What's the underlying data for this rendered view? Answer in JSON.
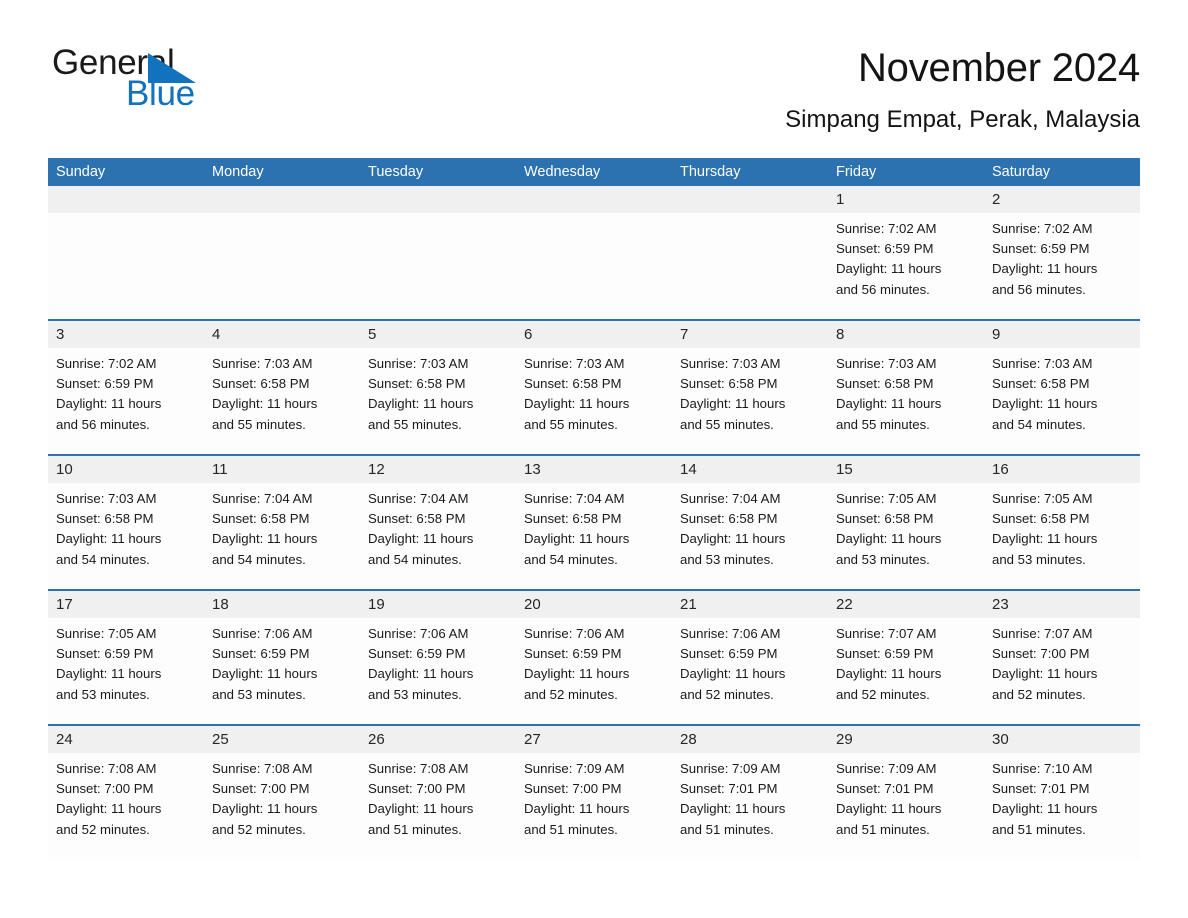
{
  "brand": {
    "name_part1": "General",
    "name_part2": "Blue",
    "triangle_icon": "triangle-icon",
    "accent_color": "#1272bd"
  },
  "header": {
    "title": "November 2024",
    "subtitle": "Simpang Empat, Perak, Malaysia"
  },
  "theme": {
    "header_blue": "#2c72b0",
    "daynum_band": "#f0f0f0",
    "cell_background": "#fdfdfd",
    "text_color": "#1a1a1a"
  },
  "weekday_headers": [
    "Sunday",
    "Monday",
    "Tuesday",
    "Wednesday",
    "Thursday",
    "Friday",
    "Saturday"
  ],
  "weeks": [
    {
      "days": [
        {
          "num": "",
          "lines": []
        },
        {
          "num": "",
          "lines": []
        },
        {
          "num": "",
          "lines": []
        },
        {
          "num": "",
          "lines": []
        },
        {
          "num": "",
          "lines": []
        },
        {
          "num": "1",
          "lines": [
            "Sunrise: 7:02 AM",
            "Sunset: 6:59 PM",
            "Daylight: 11 hours",
            "and 56 minutes."
          ]
        },
        {
          "num": "2",
          "lines": [
            "Sunrise: 7:02 AM",
            "Sunset: 6:59 PM",
            "Daylight: 11 hours",
            "and 56 minutes."
          ]
        }
      ]
    },
    {
      "days": [
        {
          "num": "3",
          "lines": [
            "Sunrise: 7:02 AM",
            "Sunset: 6:59 PM",
            "Daylight: 11 hours",
            "and 56 minutes."
          ]
        },
        {
          "num": "4",
          "lines": [
            "Sunrise: 7:03 AM",
            "Sunset: 6:58 PM",
            "Daylight: 11 hours",
            "and 55 minutes."
          ]
        },
        {
          "num": "5",
          "lines": [
            "Sunrise: 7:03 AM",
            "Sunset: 6:58 PM",
            "Daylight: 11 hours",
            "and 55 minutes."
          ]
        },
        {
          "num": "6",
          "lines": [
            "Sunrise: 7:03 AM",
            "Sunset: 6:58 PM",
            "Daylight: 11 hours",
            "and 55 minutes."
          ]
        },
        {
          "num": "7",
          "lines": [
            "Sunrise: 7:03 AM",
            "Sunset: 6:58 PM",
            "Daylight: 11 hours",
            "and 55 minutes."
          ]
        },
        {
          "num": "8",
          "lines": [
            "Sunrise: 7:03 AM",
            "Sunset: 6:58 PM",
            "Daylight: 11 hours",
            "and 55 minutes."
          ]
        },
        {
          "num": "9",
          "lines": [
            "Sunrise: 7:03 AM",
            "Sunset: 6:58 PM",
            "Daylight: 11 hours",
            "and 54 minutes."
          ]
        }
      ]
    },
    {
      "days": [
        {
          "num": "10",
          "lines": [
            "Sunrise: 7:03 AM",
            "Sunset: 6:58 PM",
            "Daylight: 11 hours",
            "and 54 minutes."
          ]
        },
        {
          "num": "11",
          "lines": [
            "Sunrise: 7:04 AM",
            "Sunset: 6:58 PM",
            "Daylight: 11 hours",
            "and 54 minutes."
          ]
        },
        {
          "num": "12",
          "lines": [
            "Sunrise: 7:04 AM",
            "Sunset: 6:58 PM",
            "Daylight: 11 hours",
            "and 54 minutes."
          ]
        },
        {
          "num": "13",
          "lines": [
            "Sunrise: 7:04 AM",
            "Sunset: 6:58 PM",
            "Daylight: 11 hours",
            "and 54 minutes."
          ]
        },
        {
          "num": "14",
          "lines": [
            "Sunrise: 7:04 AM",
            "Sunset: 6:58 PM",
            "Daylight: 11 hours",
            "and 53 minutes."
          ]
        },
        {
          "num": "15",
          "lines": [
            "Sunrise: 7:05 AM",
            "Sunset: 6:58 PM",
            "Daylight: 11 hours",
            "and 53 minutes."
          ]
        },
        {
          "num": "16",
          "lines": [
            "Sunrise: 7:05 AM",
            "Sunset: 6:58 PM",
            "Daylight: 11 hours",
            "and 53 minutes."
          ]
        }
      ]
    },
    {
      "days": [
        {
          "num": "17",
          "lines": [
            "Sunrise: 7:05 AM",
            "Sunset: 6:59 PM",
            "Daylight: 11 hours",
            "and 53 minutes."
          ]
        },
        {
          "num": "18",
          "lines": [
            "Sunrise: 7:06 AM",
            "Sunset: 6:59 PM",
            "Daylight: 11 hours",
            "and 53 minutes."
          ]
        },
        {
          "num": "19",
          "lines": [
            "Sunrise: 7:06 AM",
            "Sunset: 6:59 PM",
            "Daylight: 11 hours",
            "and 53 minutes."
          ]
        },
        {
          "num": "20",
          "lines": [
            "Sunrise: 7:06 AM",
            "Sunset: 6:59 PM",
            "Daylight: 11 hours",
            "and 52 minutes."
          ]
        },
        {
          "num": "21",
          "lines": [
            "Sunrise: 7:06 AM",
            "Sunset: 6:59 PM",
            "Daylight: 11 hours",
            "and 52 minutes."
          ]
        },
        {
          "num": "22",
          "lines": [
            "Sunrise: 7:07 AM",
            "Sunset: 6:59 PM",
            "Daylight: 11 hours",
            "and 52 minutes."
          ]
        },
        {
          "num": "23",
          "lines": [
            "Sunrise: 7:07 AM",
            "Sunset: 7:00 PM",
            "Daylight: 11 hours",
            "and 52 minutes."
          ]
        }
      ]
    },
    {
      "days": [
        {
          "num": "24",
          "lines": [
            "Sunrise: 7:08 AM",
            "Sunset: 7:00 PM",
            "Daylight: 11 hours",
            "and 52 minutes."
          ]
        },
        {
          "num": "25",
          "lines": [
            "Sunrise: 7:08 AM",
            "Sunset: 7:00 PM",
            "Daylight: 11 hours",
            "and 52 minutes."
          ]
        },
        {
          "num": "26",
          "lines": [
            "Sunrise: 7:08 AM",
            "Sunset: 7:00 PM",
            "Daylight: 11 hours",
            "and 51 minutes."
          ]
        },
        {
          "num": "27",
          "lines": [
            "Sunrise: 7:09 AM",
            "Sunset: 7:00 PM",
            "Daylight: 11 hours",
            "and 51 minutes."
          ]
        },
        {
          "num": "28",
          "lines": [
            "Sunrise: 7:09 AM",
            "Sunset: 7:01 PM",
            "Daylight: 11 hours",
            "and 51 minutes."
          ]
        },
        {
          "num": "29",
          "lines": [
            "Sunrise: 7:09 AM",
            "Sunset: 7:01 PM",
            "Daylight: 11 hours",
            "and 51 minutes."
          ]
        },
        {
          "num": "30",
          "lines": [
            "Sunrise: 7:10 AM",
            "Sunset: 7:01 PM",
            "Daylight: 11 hours",
            "and 51 minutes."
          ]
        }
      ]
    }
  ]
}
